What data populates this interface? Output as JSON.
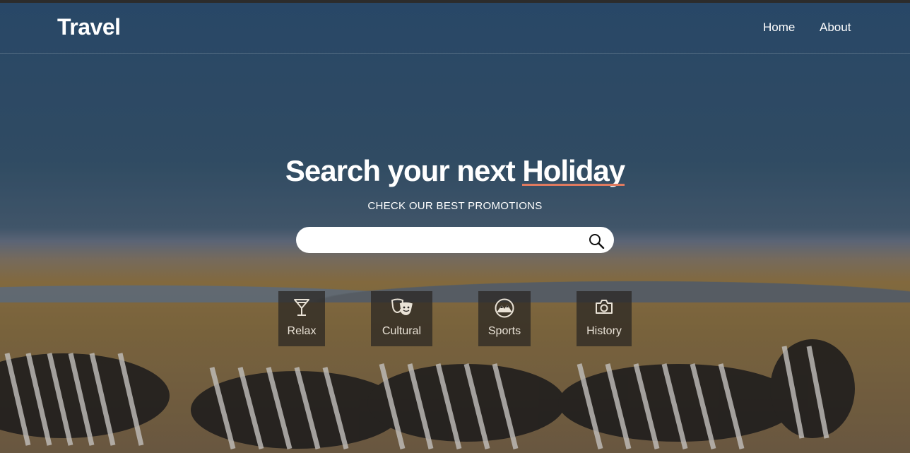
{
  "brand": "Travel",
  "nav": {
    "home": "Home",
    "about": "About"
  },
  "hero": {
    "title_prefix": "Search your next",
    "title_accent": "Holiday",
    "subtitle": "CHECK OUR BEST PROMOTIONS"
  },
  "search": {
    "value": "",
    "placeholder": ""
  },
  "categories": [
    {
      "label": "Relax",
      "icon": "cocktail-icon"
    },
    {
      "label": "Cultural",
      "icon": "theater-masks-icon"
    },
    {
      "label": "Sports",
      "icon": "mountain-icon"
    },
    {
      "label": "History",
      "icon": "camera-icon"
    }
  ],
  "colors": {
    "accent": "#e07a5f",
    "nav_bg": "#2d5174",
    "text": "#ffffff"
  }
}
